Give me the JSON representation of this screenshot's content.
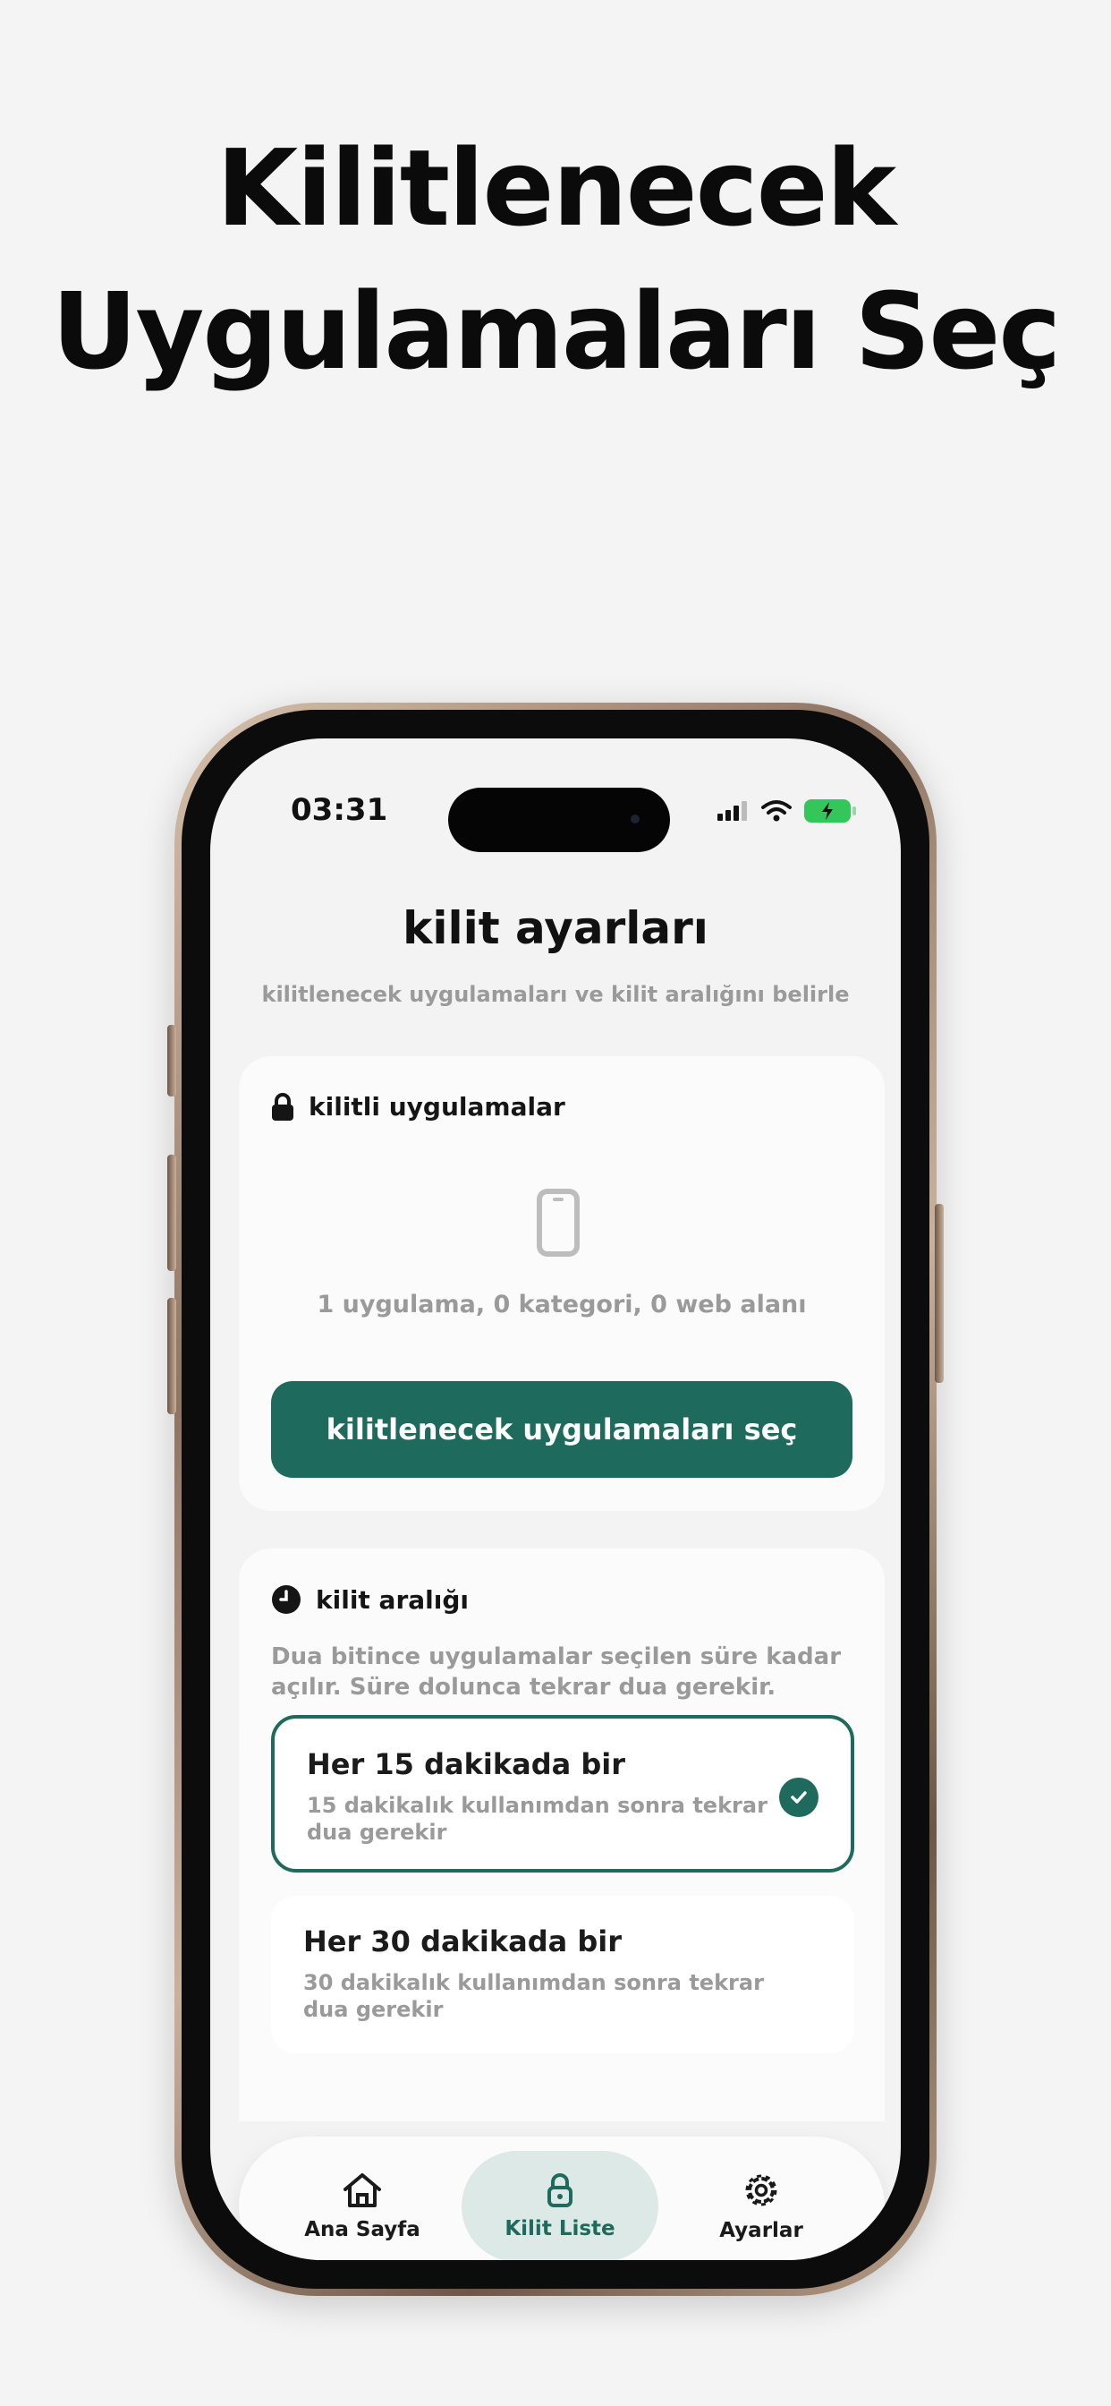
{
  "headline": {
    "line1": "Kilitlenecek",
    "line2": "Uygulamaları Seç"
  },
  "status_bar": {
    "time": "03:31"
  },
  "page": {
    "title": "kilit ayarları",
    "subtitle": "kilitlenecek uygulamaları ve kilit aralığını belirle"
  },
  "locked_apps_card": {
    "header": "kilitli uygulamalar",
    "counts": "1 uygulama, 0 kategori, 0 web alanı",
    "button_label": "kilitlenecek uygulamaları seç"
  },
  "interval_card": {
    "header": "kilit aralığı",
    "description": "Dua bitince uygulamalar seçilen süre kadar açılır. Süre dolunca tekrar dua gerekir.",
    "options": [
      {
        "title": "Her 15 dakikada bir",
        "subtitle": "15 dakikalık kullanımdan sonra tekrar dua gerekir",
        "selected": true
      },
      {
        "title": "Her 30 dakikada bir",
        "subtitle": "30 dakikalık kullanımdan sonra tekrar dua gerekir",
        "selected": false
      }
    ]
  },
  "tabbar": {
    "tabs": [
      {
        "label": "Ana Sayfa",
        "icon": "home-icon"
      },
      {
        "label": "Kilit Liste",
        "icon": "lock-icon",
        "active": true
      },
      {
        "label": "Ayarlar",
        "icon": "gear-icon"
      }
    ]
  },
  "colors": {
    "accent": "#1e6b5d",
    "accent_light": "#dde9e6",
    "battery": "#33c759"
  }
}
